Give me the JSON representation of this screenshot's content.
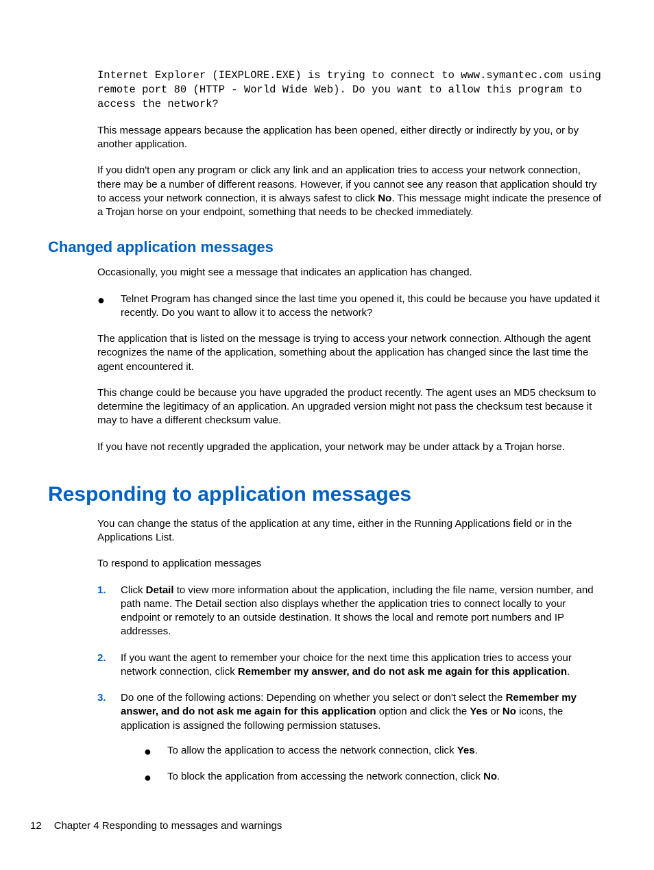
{
  "intro": {
    "mono": "Internet Explorer (IEXPLORE.EXE) is trying to connect to www.symantec.com using remote port 80 (HTTP - World Wide Web). Do you want to allow this program to access the network?",
    "p1": "This message appears because the application has been opened, either directly or indirectly by you, or by another application.",
    "p2_a": "If you didn't open any program or click any link and an application tries to access your network connection, there may be a number of different reasons. However, if you cannot see any reason that application should try to access your network connection, it is always safest to click ",
    "p2_bold": "No",
    "p2_b": ". This message might indicate the presence of a Trojan horse on your endpoint, something that needs to be checked immediately."
  },
  "changed": {
    "heading": "Changed application messages",
    "p1": "Occasionally, you might see a message that indicates an application has changed.",
    "bullet_mono": "Telnet Program has changed since the last time you opened it, this could be because you have updated it recently. Do you want to allow it to access the network?",
    "p2": "The application that is listed on the message is trying to access your network connection. Although the agent recognizes the name of the application, something about the application has changed since the last time the agent encountered it.",
    "p3": "This change could be because you have upgraded the product recently. The agent uses an MD5 checksum to determine the legitimacy of an application. An upgraded version might not pass the checksum test because it may to have a different checksum value.",
    "p4": "If you have not recently upgraded the application, your network may be under attack by a Trojan horse."
  },
  "responding": {
    "heading": "Responding to application messages",
    "p1": "You can change the status of the application at any time, either in the Running Applications field or in the Applications List.",
    "p2": "To respond to application messages",
    "step1_n": "1.",
    "step1_a": "Click ",
    "step1_bold": "Detail",
    "step1_b": " to view more information about the application, including the file name, version number, and path name. The Detail section also displays whether the application tries to connect locally to your endpoint or remotely to an outside destination. It shows the local and remote port numbers and IP addresses.",
    "step2_n": "2.",
    "step2_a": "If you want the agent to remember your choice for the next time this application tries to access your network connection, click ",
    "step2_bold": "Remember my answer, and do not ask me again for this application",
    "step2_b": ".",
    "step3_n": "3.",
    "step3_a": "Do one of the following actions: Depending on whether you select or don't select the ",
    "step3_bold1": "Remember my answer, and do not ask me again for this application",
    "step3_mid": " option and click the ",
    "step3_bold2": "Yes",
    "step3_or": " or ",
    "step3_bold3": "No",
    "step3_b": " icons, the application is assigned the following permission statuses.",
    "sub1_a": "To allow the application to access the network connection, click ",
    "sub1_bold": "Yes",
    "sub1_b": ".",
    "sub2_a": "To block the application from accessing the network connection, click ",
    "sub2_bold": "No",
    "sub2_b": "."
  },
  "footer": {
    "page": "12",
    "chapter": "Chapter 4   Responding to messages and warnings"
  }
}
